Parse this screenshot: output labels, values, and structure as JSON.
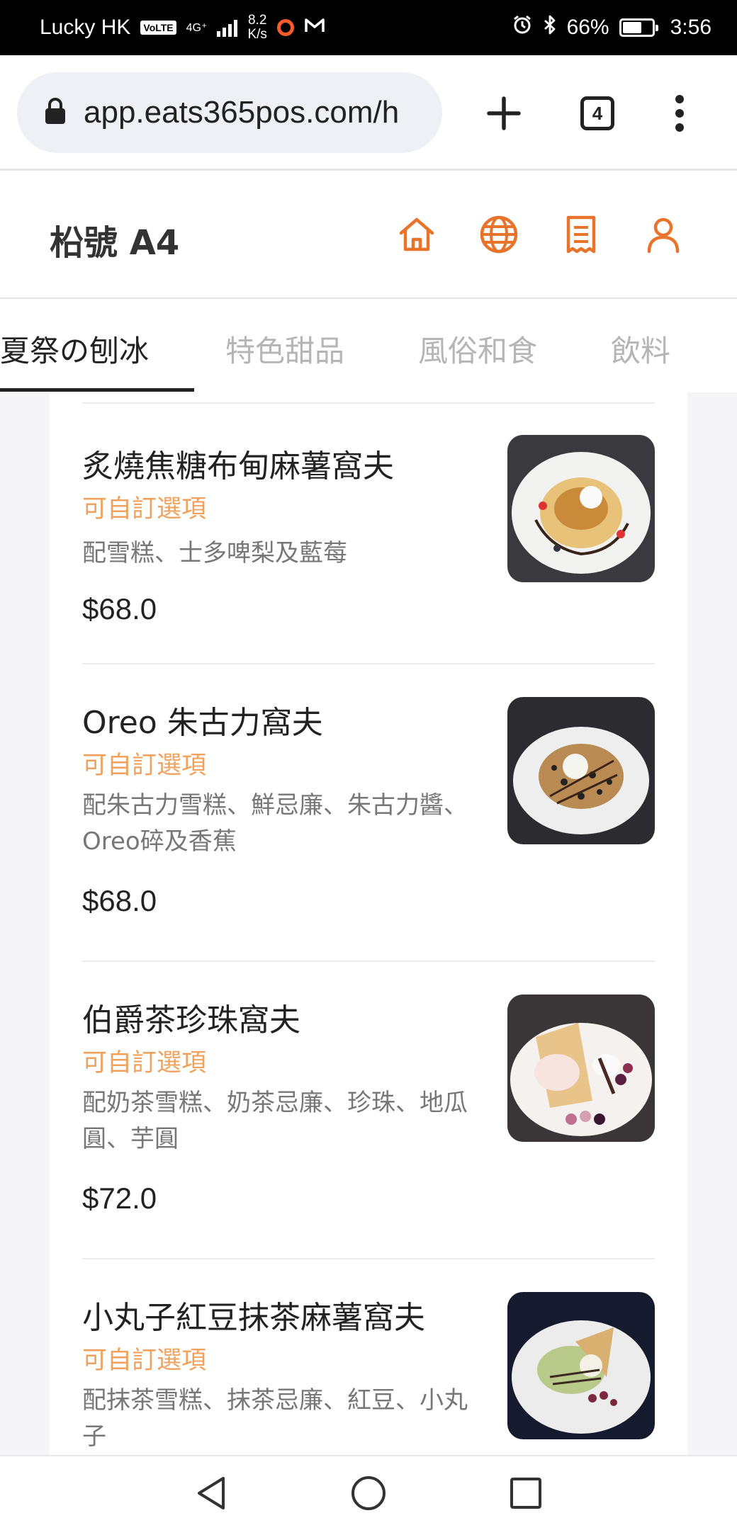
{
  "status_bar": {
    "carrier": "Lucky HK",
    "volte": "VoLTE",
    "network": "4G⁺",
    "speed_value": "8.2",
    "speed_unit": "K/s",
    "battery": "66%",
    "battery_level": 0.66,
    "time": "3:56"
  },
  "browser": {
    "url": "app.eats365pos.com/h",
    "tab_count": "4"
  },
  "header": {
    "store_name": "柗號 A4",
    "icons": [
      "home-icon",
      "globe-icon",
      "receipt-icon",
      "user-icon"
    ]
  },
  "tabs": [
    {
      "label": "夏祭の刨冰",
      "active": true
    },
    {
      "label": "特色甜品",
      "active": false
    },
    {
      "label": "風俗和食",
      "active": false
    },
    {
      "label": "飲料",
      "active": false
    }
  ],
  "menu_items": [
    {
      "name": "炙燒焦糖布甸麻薯窩夫",
      "option": "可自訂選項",
      "description": "配雪糕、士多啤梨及藍莓",
      "price": "$68.0"
    },
    {
      "name": "Oreo 朱古力窩夫",
      "option": "可自訂選項",
      "description": "配朱古力雪糕、鮮忌廉、朱古力醬、Oreo碎及香蕉",
      "price": "$68.0"
    },
    {
      "name": "伯爵茶珍珠窩夫",
      "option": "可自訂選項",
      "description": "配奶茶雪糕、奶茶忌廉、珍珠、地瓜圓、芋圓",
      "price": "$72.0"
    },
    {
      "name": "小丸子紅豆抹茶麻薯窩夫",
      "option": "可自訂選項",
      "description": "配抹茶雪糕、抹茶忌廉、紅豆、小丸子",
      "price": ""
    }
  ],
  "colors": {
    "accent": "#e8742c",
    "option_text": "#f0a25c",
    "status_bar_bg": "#000000"
  }
}
